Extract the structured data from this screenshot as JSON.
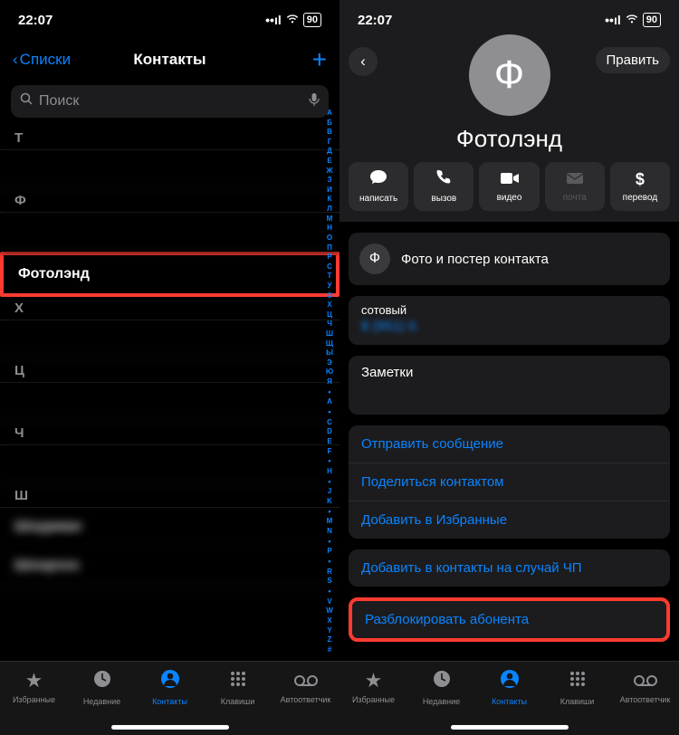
{
  "status": {
    "time": "22:07",
    "battery": "90"
  },
  "left": {
    "back_label": "Списки",
    "title": "Контакты",
    "search_placeholder": "Поиск",
    "sections": {
      "t": "Т",
      "f": "Ф",
      "x": "Х",
      "ts": "Ц",
      "ch": "Ч",
      "sh": "Ш"
    },
    "contacts": {
      "fotoland": "Фотолэнд",
      "sh1": "Шоурман",
      "sh2": "Шонроэз"
    },
    "index": [
      "А",
      "Б",
      "В",
      "Г",
      "Д",
      "Е",
      "Ж",
      "З",
      "И",
      "К",
      "Л",
      "М",
      "Н",
      "О",
      "П",
      "Р",
      "С",
      "Т",
      "У",
      "Ф",
      "Х",
      "Ц",
      "Ч",
      "Ш",
      "Щ",
      "Ы",
      "Э",
      "Ю",
      "Я",
      "A",
      "C",
      "D",
      "E",
      "F",
      "H",
      "J",
      "K",
      "M",
      "N",
      "P",
      "R",
      "S",
      "V",
      "W",
      "X",
      "Y",
      "Z",
      "#"
    ]
  },
  "right": {
    "edit_label": "Править",
    "avatar_letter": "Ф",
    "name": "Фотолэнд",
    "actions": {
      "message": "написать",
      "call": "вызов",
      "video": "видео",
      "mail": "почта",
      "pay": "перевод"
    },
    "poster_label": "Фото и постер контакта",
    "phone_type": "сотовый",
    "phone_value": "8 (951)   0.",
    "notes_label": "Заметки",
    "links": {
      "send_msg": "Отправить сообщение",
      "share": "Поделиться контактом",
      "fav": "Добавить в Избранные",
      "emergency": "Добавить в контакты на случай ЧП",
      "unblock": "Разблокировать абонента"
    }
  },
  "tabs": {
    "favorites": "Избранные",
    "recent": "Недавние",
    "contacts": "Контакты",
    "keypad": "Клавиши",
    "voicemail": "Автоответчик"
  }
}
